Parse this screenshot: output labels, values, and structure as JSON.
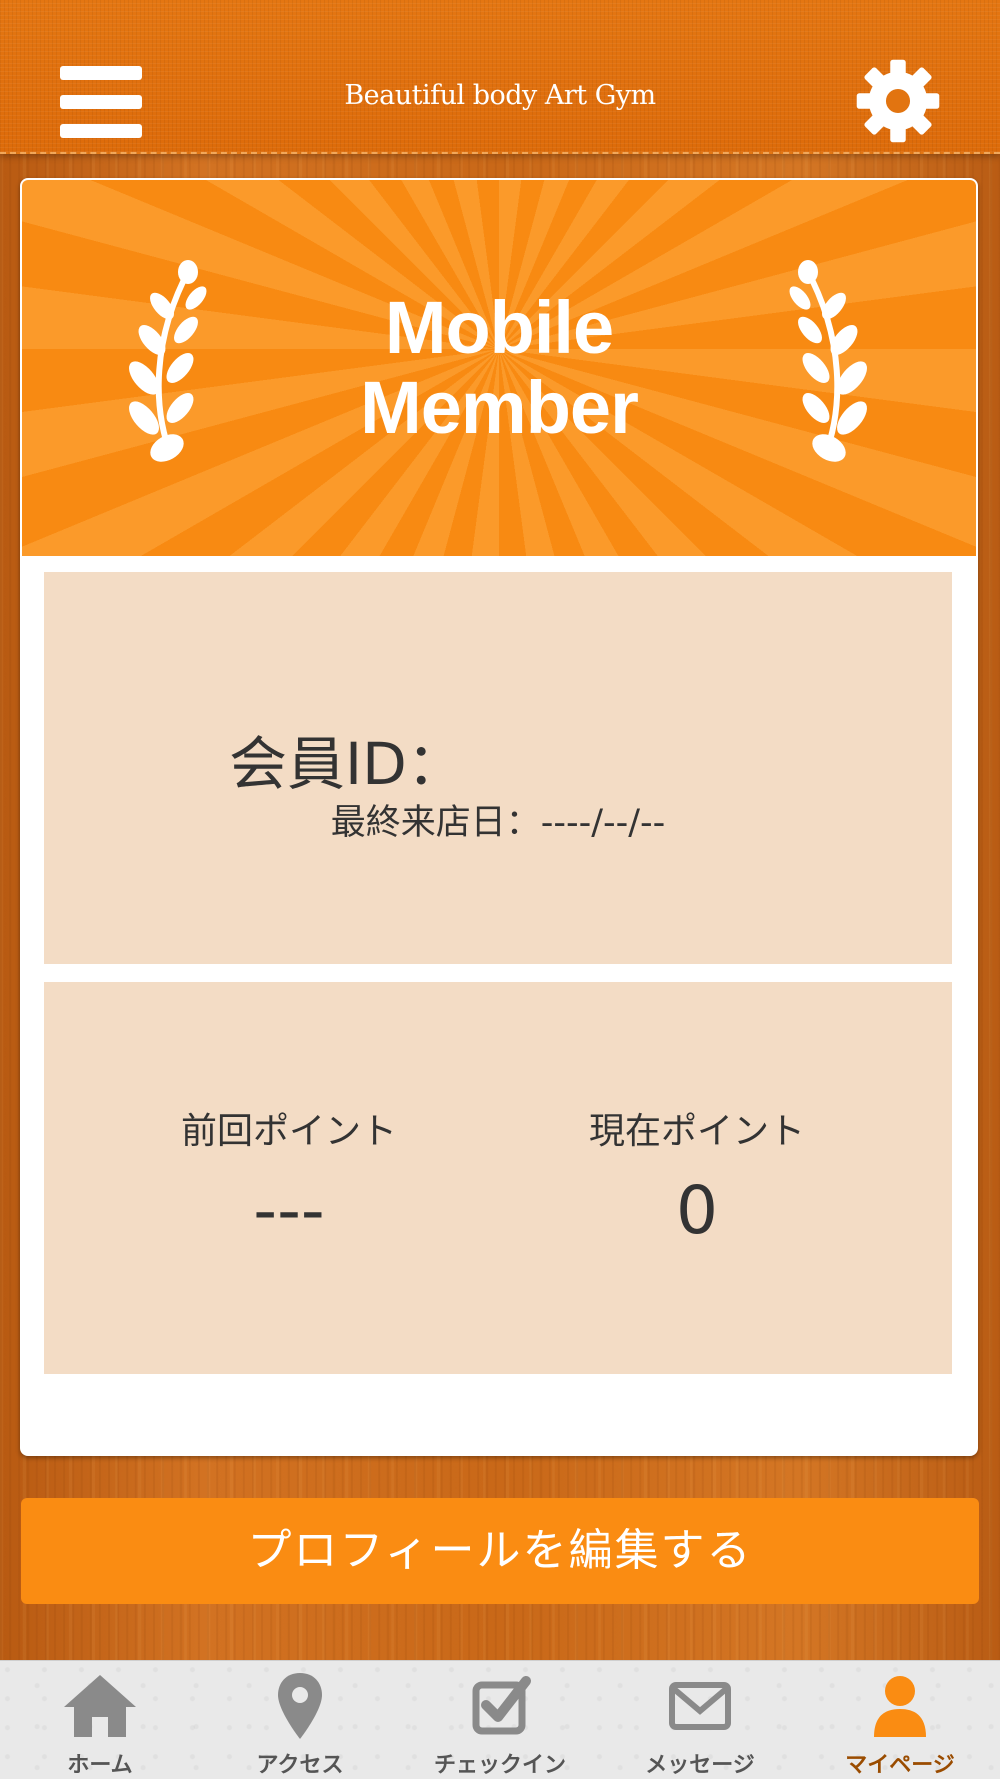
{
  "header": {
    "title": "Beautiful body Art Gym",
    "menu_icon": "hamburger-menu-icon",
    "settings_icon": "gear-icon"
  },
  "banner": {
    "line1": "Mobile",
    "line2": "Member"
  },
  "member": {
    "id_label": "会員ID：",
    "last_visit": "最終来店日：----/--/--"
  },
  "points": {
    "previous_label": "前回ポイント",
    "previous_value": "---",
    "current_label": "現在ポイント",
    "current_value": "0"
  },
  "edit_profile_label": "プロフィールを編集する",
  "tabs": [
    {
      "label": "ホーム",
      "icon": "home-icon"
    },
    {
      "label": "アクセス",
      "icon": "map-pin-icon"
    },
    {
      "label": "チェックイン",
      "icon": "checkbox-icon"
    },
    {
      "label": "メッセージ",
      "icon": "envelope-icon"
    },
    {
      "label": "マイページ",
      "icon": "user-icon",
      "active": true
    }
  ],
  "colors": {
    "header": "#e47612",
    "accent": "#fa8c12",
    "panel": "#f3dcc5",
    "tab_inactive": "#8a8a8a",
    "tab_active": "#fa8c12"
  }
}
